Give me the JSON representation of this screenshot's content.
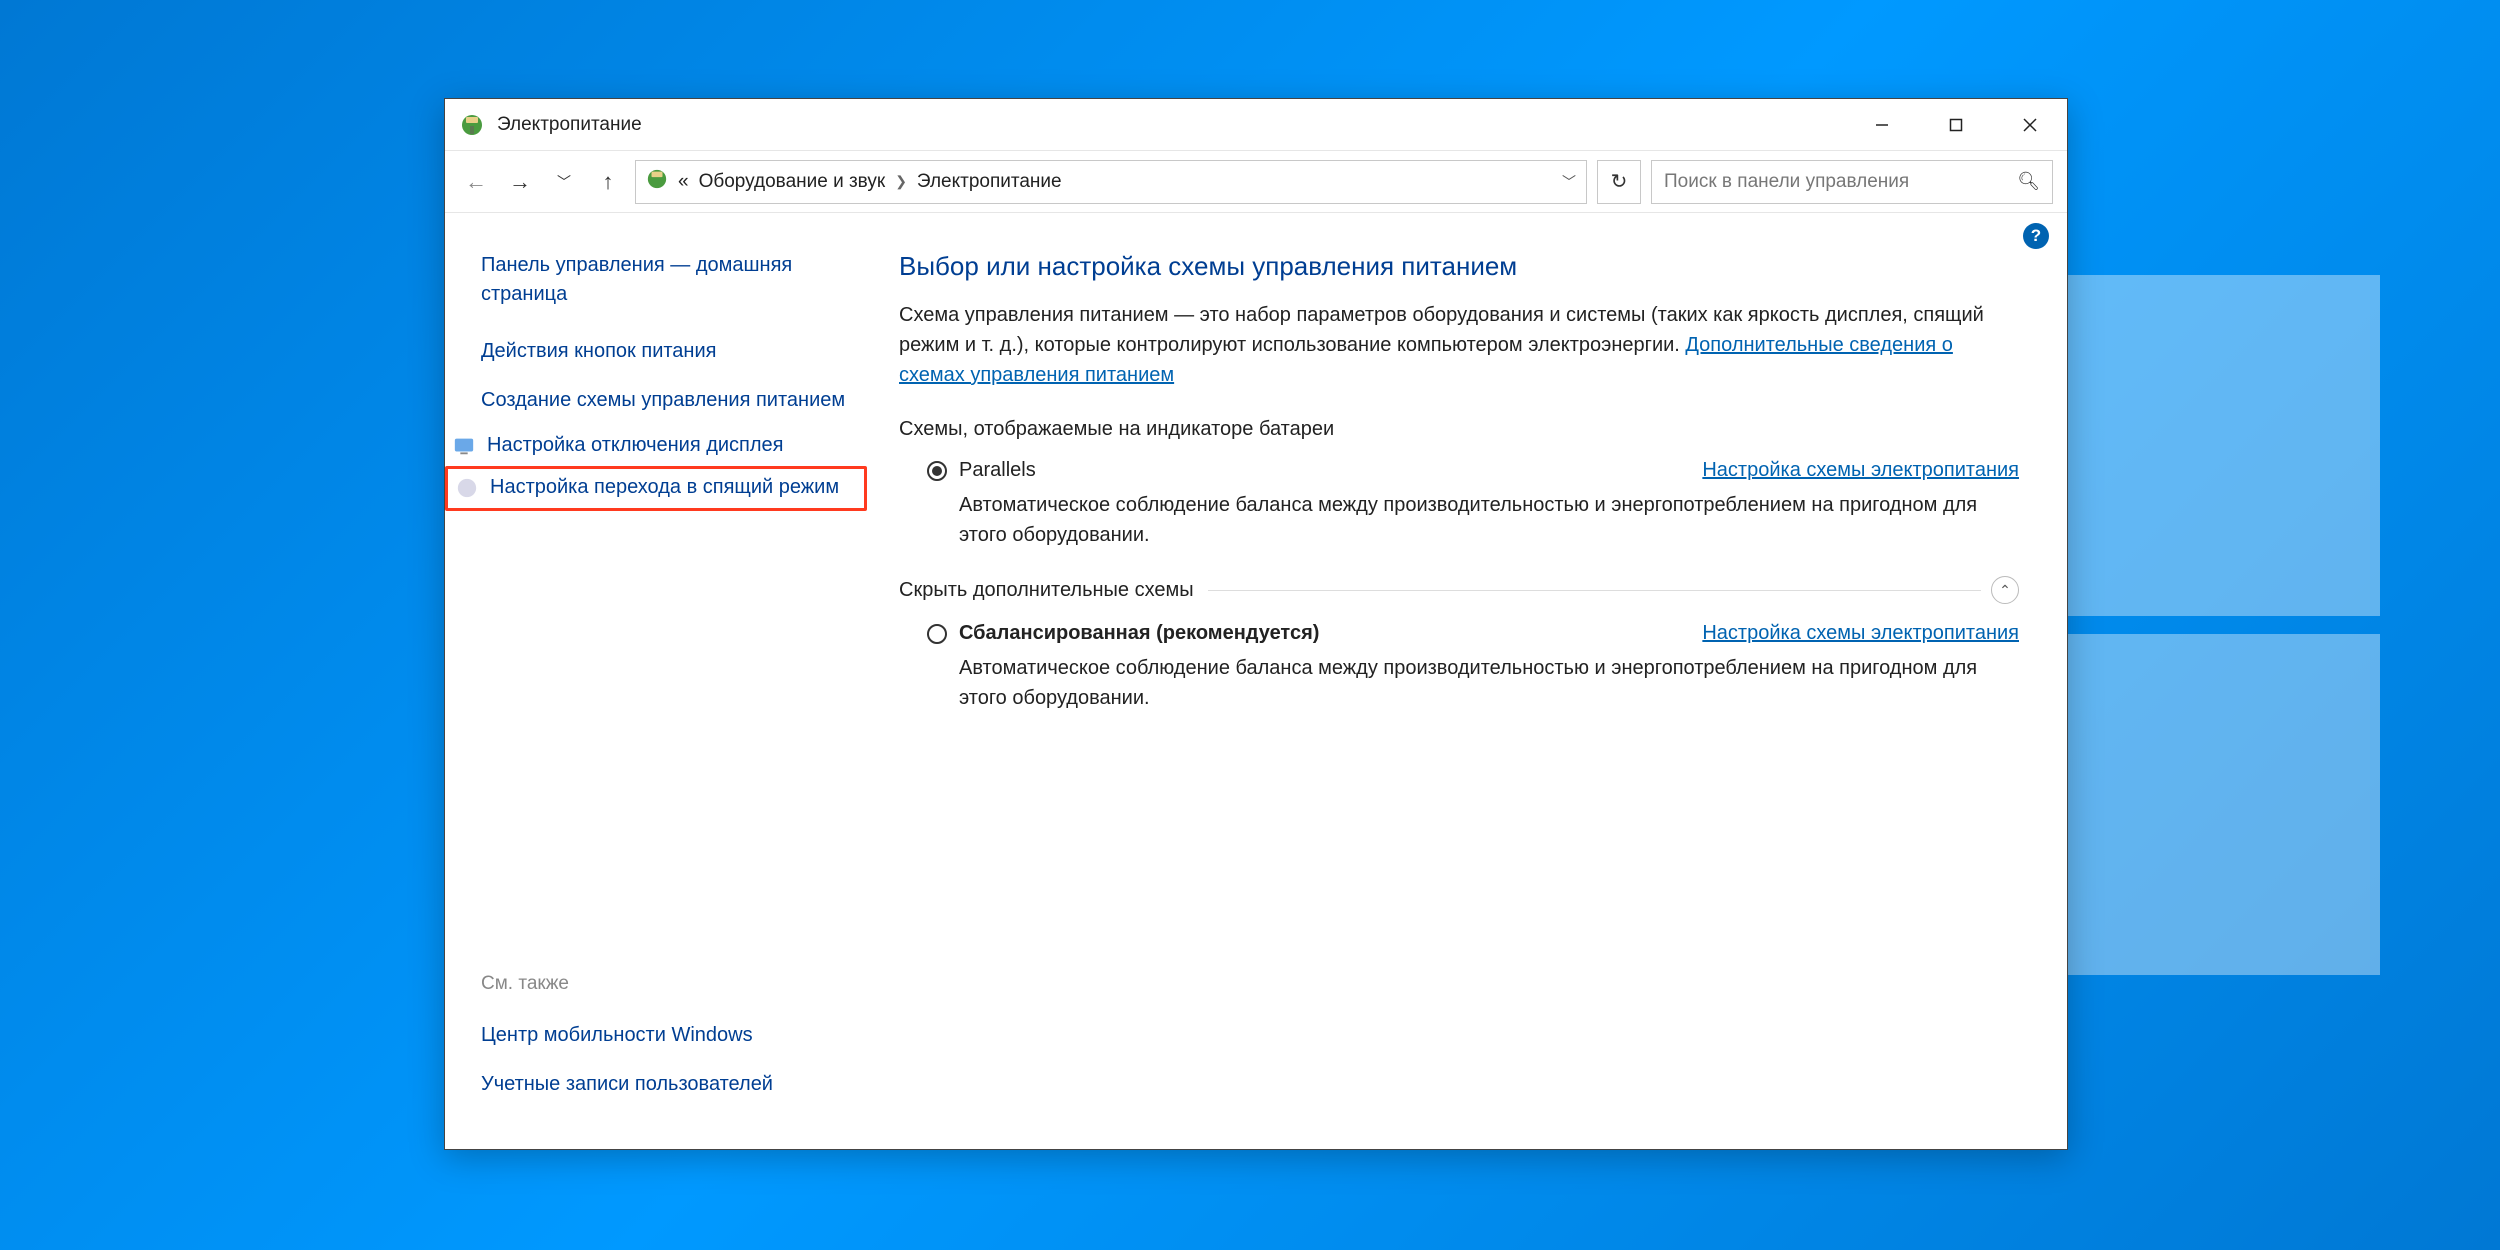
{
  "window": {
    "title": "Электропитание"
  },
  "breadcrumb": {
    "item1": "Оборудование и звук",
    "item2": "Электропитание"
  },
  "search": {
    "placeholder": "Поиск в панели управления"
  },
  "sidebar": {
    "home": "Панель управления — домашняя страница",
    "items": [
      {
        "label": "Действия кнопок питания"
      },
      {
        "label": "Создание схемы управления питанием"
      },
      {
        "label": "Настройка отключения дисплея"
      },
      {
        "label": "Настройка перехода в спящий режим"
      }
    ],
    "see_also_hdr": "См. также",
    "see_also": [
      {
        "label": "Центр мобильности Windows"
      },
      {
        "label": "Учетные записи пользователей"
      }
    ]
  },
  "main": {
    "heading": "Выбор или настройка схемы управления питанием",
    "description_pre": "Схема управления питанием — это набор параметров оборудования и системы (таких как яркость дисплея, спящий режим и т. д.), которые контролируют использование компьютером электроэнергии. ",
    "description_link": "Дополнительные сведения о схемах управления питанием",
    "section1": "Схемы, отображаемые на индикаторе батареи",
    "section2": "Скрыть дополнительные схемы",
    "plan1": {
      "name": "Parallels",
      "link": "Настройка схемы электропитания",
      "desc": "Автоматическое соблюдение баланса между производительностью и энергопотреблением на пригодном для этого оборудовании."
    },
    "plan2": {
      "name": "Сбалансированная (рекомендуется)",
      "link": "Настройка схемы электропитания",
      "desc": "Автоматическое соблюдение баланса между производительностью и энергопотреблением на пригодном для этого оборудовании."
    }
  }
}
